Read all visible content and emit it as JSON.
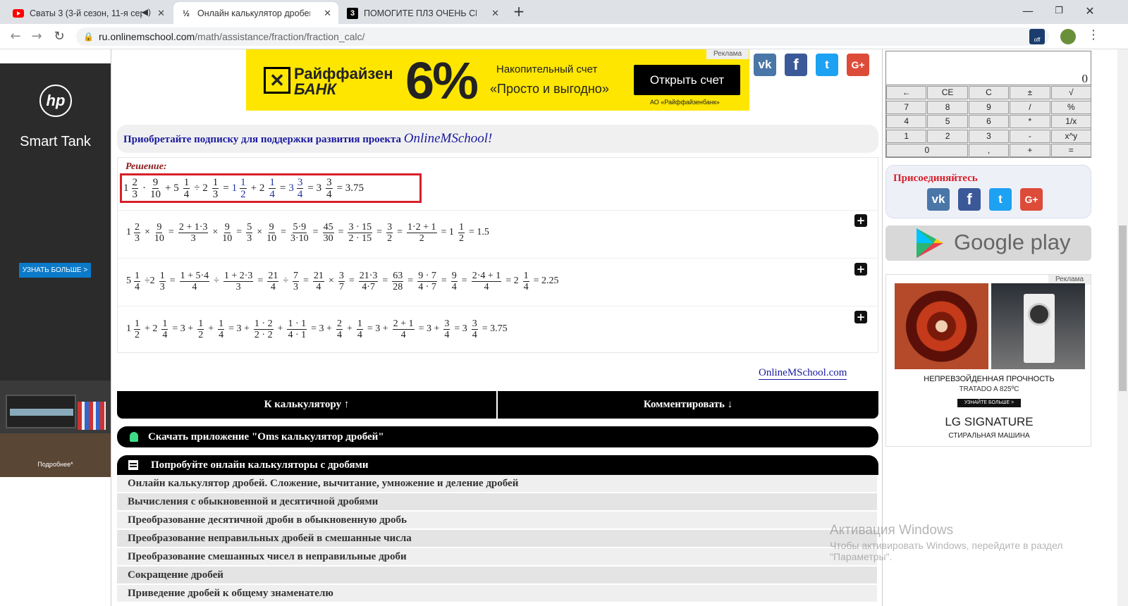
{
  "browser": {
    "tabs": [
      {
        "title": "Сваты 3 (3-й сезон, 11-я сер",
        "icon": "youtube-icon",
        "color": "#ff0000"
      },
      {
        "title": "Онлайн калькулятор дробей. Вы",
        "icon": "onlinemschool-icon",
        "color": "#333333"
      },
      {
        "title": "ПОМОГИТЕ ПЛЗ ОЧЕНЬ СРОЧН",
        "icon": "znanija-icon",
        "color": "#000000"
      }
    ],
    "new_tab": "+",
    "url_host": "ru.onlinemschool.com",
    "url_path": "/math/assistance/fraction/fraction_calc/",
    "ext_badge": "off"
  },
  "left_ad": {
    "brand": "hp",
    "title": "Smart Tank",
    "cta": "УЗНАТЬ БОЛЬШЕ >",
    "footer": "Подробнее*"
  },
  "top_ad": {
    "bank1": "Райффайзен",
    "bank2": "БАНК",
    "percent": "6%",
    "line1": "Накопительный счет",
    "line2": "«Просто и выгодно»",
    "button": "Открыть счет",
    "legal": "АО «Райффайзенбанк»",
    "label": "Реклама"
  },
  "share": {
    "vk": "vk",
    "fb": "f",
    "tw": "t",
    "gp": "G+"
  },
  "subscribe": {
    "text": "Приобретайте подписку для поддержки развития проекта ",
    "brand": "OnlineMSchool!"
  },
  "solution": {
    "label": "Решение:",
    "main": [
      {
        "w": "1",
        "n": "2",
        "d": "3"
      },
      {
        "op": "·"
      },
      {
        "n": "9",
        "d": "10"
      },
      {
        "op": "+ 5"
      },
      {
        "n": "1",
        "d": "4"
      },
      {
        "op": "÷ 2"
      },
      {
        "n": "1",
        "d": "3"
      },
      {
        "op": "="
      },
      {
        "w": "1",
        "n": "1",
        "d": "2",
        "blue": true
      },
      {
        "op": "+ 2"
      },
      {
        "n": "1",
        "d": "4",
        "blue": true
      },
      {
        "op": "="
      },
      {
        "w": "3",
        "n": "3",
        "d": "4",
        "blue": true
      },
      {
        "op": "= 3"
      },
      {
        "n": "3",
        "d": "4"
      },
      {
        "op": "= 3.75"
      }
    ],
    "step1": [
      {
        "w": "1",
        "n": "2",
        "d": "3"
      },
      {
        "op": "×"
      },
      {
        "n": "9",
        "d": "10"
      },
      {
        "op": "="
      },
      {
        "n": "2 + 1·3",
        "d": "3"
      },
      {
        "op": "×"
      },
      {
        "n": "9",
        "d": "10"
      },
      {
        "op": "="
      },
      {
        "n": "5",
        "d": "3"
      },
      {
        "op": "×"
      },
      {
        "n": "9",
        "d": "10"
      },
      {
        "op": "="
      },
      {
        "n": "5·9",
        "d": "3·10"
      },
      {
        "op": "="
      },
      {
        "n": "45",
        "d": "30"
      },
      {
        "op": "="
      },
      {
        "n": "3 · 15",
        "d": "2 · 15"
      },
      {
        "op": "="
      },
      {
        "n": "3",
        "d": "2"
      },
      {
        "op": "="
      },
      {
        "n": "1·2 + 1",
        "d": "2"
      },
      {
        "op": "= 1"
      },
      {
        "n": "1",
        "d": "2"
      },
      {
        "op": "= 1.5"
      }
    ],
    "step2": [
      {
        "w": "5",
        "n": "1",
        "d": "4"
      },
      {
        "op": "÷2"
      },
      {
        "n": "1",
        "d": "3"
      },
      {
        "op": "="
      },
      {
        "n": "1 + 5·4",
        "d": "4"
      },
      {
        "op": "÷"
      },
      {
        "n": "1 + 2·3",
        "d": "3"
      },
      {
        "op": "="
      },
      {
        "n": "21",
        "d": "4"
      },
      {
        "op": "÷"
      },
      {
        "n": "7",
        "d": "3"
      },
      {
        "op": "="
      },
      {
        "n": "21",
        "d": "4"
      },
      {
        "op": "×"
      },
      {
        "n": "3",
        "d": "7"
      },
      {
        "op": "="
      },
      {
        "n": "21·3",
        "d": "4·7"
      },
      {
        "op": "="
      },
      {
        "n": "63",
        "d": "28"
      },
      {
        "op": "="
      },
      {
        "n": "9 · 7",
        "d": "4 · 7"
      },
      {
        "op": "="
      },
      {
        "n": "9",
        "d": "4"
      },
      {
        "op": "="
      },
      {
        "n": "2·4 + 1",
        "d": "4"
      },
      {
        "op": "= 2"
      },
      {
        "n": "1",
        "d": "4"
      },
      {
        "op": "= 2.25"
      }
    ],
    "step3": [
      {
        "w": "1",
        "n": "1",
        "d": "2"
      },
      {
        "op": "+ 2"
      },
      {
        "n": "1",
        "d": "4"
      },
      {
        "op": "= 3 +"
      },
      {
        "n": "1",
        "d": "2"
      },
      {
        "op": "+"
      },
      {
        "n": "1",
        "d": "4"
      },
      {
        "op": "= 3 +"
      },
      {
        "n": "1 · 2",
        "d": "2 · 2"
      },
      {
        "op": "+"
      },
      {
        "n": "1 · 1",
        "d": "4 · 1"
      },
      {
        "op": "= 3 +"
      },
      {
        "n": "2",
        "d": "4"
      },
      {
        "op": "+"
      },
      {
        "n": "1",
        "d": "4"
      },
      {
        "op": "= 3 +"
      },
      {
        "n": "2 + 1",
        "d": "4"
      },
      {
        "op": "= 3 +"
      },
      {
        "n": "3",
        "d": "4"
      },
      {
        "op": "= 3"
      },
      {
        "n": "3",
        "d": "4"
      },
      {
        "op": "= 3.75"
      }
    ]
  },
  "site_link": "OnlineMSchool.com",
  "buttons": {
    "to_calc": "К калькулятору ↑",
    "comment": "Комментировать ↓",
    "download": "Скачать приложение \"Oms калькулятор дробей\"",
    "try": "Попробуйте онлайн калькуляторы с дробями"
  },
  "links": [
    "Онлайн калькулятор дробей. Сложение, вычитание, умножение и деление дробей",
    "Вычисления с обыкновенной и десятичной дробями",
    "Преобразование десятичной дроби в обыкновенную дробь",
    "Преобразование неправильных дробей в смешанные числа",
    "Преобразование смешанных чисел в неправильные дроби",
    "Сокращение дробей",
    "Приведение дробей к общему знаменателю"
  ],
  "calculator": {
    "display": "0",
    "rows": [
      [
        "←",
        "CE",
        "C",
        "±",
        "√"
      ],
      [
        "7",
        "8",
        "9",
        "/",
        "%"
      ],
      [
        "4",
        "5",
        "6",
        "*",
        "1/x"
      ],
      [
        "1",
        "2",
        "3",
        "-",
        "x^y"
      ],
      [
        "0",
        ",",
        "+",
        "="
      ]
    ]
  },
  "join": "Присоединяйтесь",
  "google_play": "Google play",
  "right_ad": {
    "label": "Реклама",
    "line1": "НЕПРЕВЗОЙДЕННАЯ ПРОЧНОСТЬ",
    "line2": "TRATADO A 825ºC",
    "cta": "УЗНАЙТЕ БОЛЬШЕ >",
    "brand": "LG SIGNATURE",
    "product": "СТИРАЛЬНАЯ МАШИНА"
  },
  "watermark": {
    "title": "Активация Windows",
    "text1": "Чтобы активировать Windows, перейдите в раздел",
    "text2": "\"Параметры\"."
  }
}
